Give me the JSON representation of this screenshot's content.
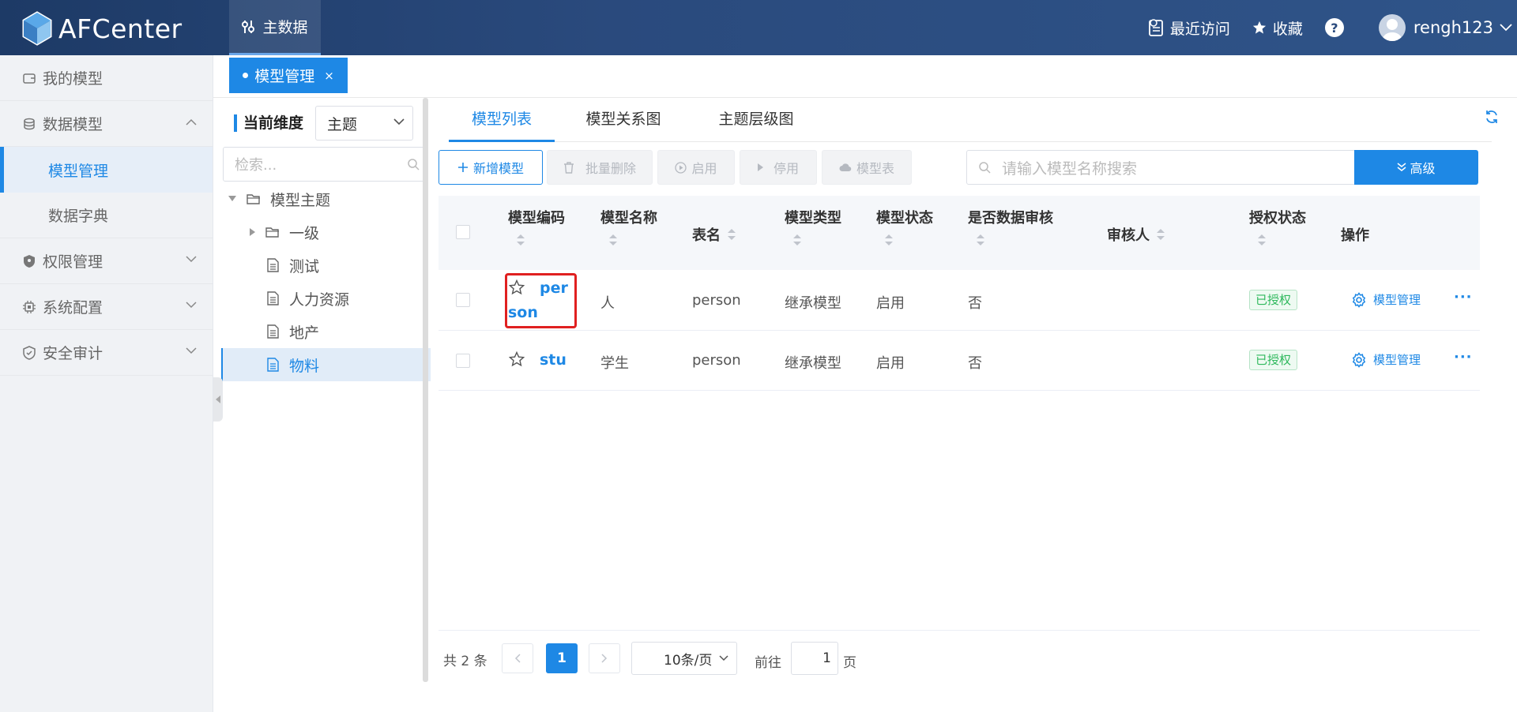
{
  "app": {
    "title": "AFCenter"
  },
  "top_nav": {
    "label": "主数据"
  },
  "header_right": {
    "recent": "最近访问",
    "favorites": "收藏",
    "help": "?",
    "user": "rengh123"
  },
  "sidebar": {
    "items": [
      {
        "label": "我的模型"
      },
      {
        "label": "数据模型"
      },
      {
        "label": "模型管理"
      },
      {
        "label": "数据字典"
      },
      {
        "label": "权限管理"
      },
      {
        "label": "系统配置"
      },
      {
        "label": "安全审计"
      }
    ]
  },
  "tabbar": {
    "tab_label": "模型管理",
    "close": "×"
  },
  "tree": {
    "dimension_label": "当前维度",
    "dimension_value": "主题",
    "search_placeholder": "检索...",
    "nodes": [
      {
        "label": "模型主题"
      },
      {
        "label": "一级"
      },
      {
        "label": "测试"
      },
      {
        "label": "人力资源"
      },
      {
        "label": "地产"
      },
      {
        "label": "物料"
      }
    ]
  },
  "subtabs": [
    {
      "label": "模型列表"
    },
    {
      "label": "模型关系图"
    },
    {
      "label": "主题层级图"
    }
  ],
  "toolbar": {
    "add": "新增模型",
    "batch_delete": "批量删除",
    "enable": "启用",
    "disable": "停用",
    "model_table": "模型表",
    "search_placeholder": "请输入模型名称搜索",
    "advanced": "高级"
  },
  "table": {
    "columns": [
      "模型编码",
      "模型名称",
      "表名",
      "模型类型",
      "模型状态",
      "是否数据审核",
      "审核人",
      "授权状态",
      "操作"
    ],
    "rows": [
      {
        "code_a": "per",
        "code_b": "son",
        "name": "人",
        "table": "person",
        "type": "继承模型",
        "status": "启用",
        "audit": "否",
        "auditor": "",
        "auth": "已授权",
        "op": "模型管理",
        "more": "···"
      },
      {
        "code_a": "stu",
        "code_b": "",
        "name": "学生",
        "table": "person",
        "type": "继承模型",
        "status": "启用",
        "audit": "否",
        "auditor": "",
        "auth": "已授权",
        "op": "模型管理",
        "more": "···"
      }
    ]
  },
  "pager": {
    "total": "共 2 条",
    "current": "1",
    "size": "10条/页",
    "goto": "前往",
    "goto_value": "1",
    "page": "页"
  },
  "colors": {
    "primary": "#1e88e5",
    "header": "#2a4a7d",
    "highlight": "#e02020"
  }
}
